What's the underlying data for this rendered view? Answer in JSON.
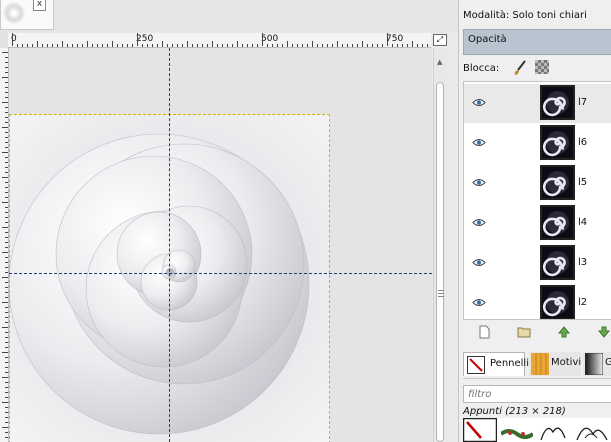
{
  "image_tab": {
    "close_glyph": "x"
  },
  "ruler": {
    "labels": [
      "0",
      "250",
      "500",
      "750"
    ]
  },
  "zoom_button": {
    "icon": "zoom-fit-icon",
    "glyph": "⤢"
  },
  "dock": {
    "mode_text": "Modalità: Solo toni chiari",
    "opacity_label": "Opacità",
    "lock_label": "Blocca:",
    "layers": [
      {
        "name": "l7",
        "visible": true
      },
      {
        "name": "l6",
        "visible": true
      },
      {
        "name": "l5",
        "visible": true
      },
      {
        "name": "l4",
        "visible": true
      },
      {
        "name": "l3",
        "visible": true
      },
      {
        "name": "l2",
        "visible": true
      }
    ],
    "tabs": {
      "pennelli": "Pennelli",
      "motivi": "Motivi",
      "third": "G"
    },
    "filter_placeholder": "filtro",
    "clipboard_label": "Appunti (213 × 218)"
  },
  "colors": {
    "guide": "#1f3e7a",
    "selection_border": "#d0b400",
    "opacity_bg": "#b8c4cf"
  }
}
